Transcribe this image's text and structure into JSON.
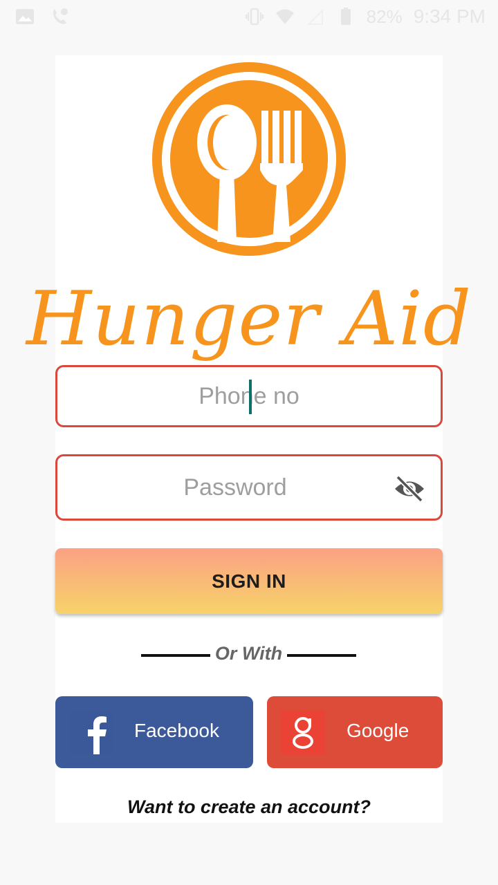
{
  "status_bar": {
    "battery": "82%",
    "time": "9:34 PM",
    "icons": [
      "image-icon",
      "phone-icon",
      "vibrate-icon",
      "wifi-icon",
      "signal-icon",
      "battery-icon"
    ]
  },
  "app": {
    "title": "Hunger Aid",
    "logo": "spoon-fork-logo",
    "accent_color": "#f7941d"
  },
  "form": {
    "phone_placeholder": "Phone no",
    "password_placeholder": "Password",
    "field_border_color": "#d9483b",
    "signin_label": "SIGN IN"
  },
  "divider": {
    "text": "Or With"
  },
  "social": {
    "facebook_label": "Facebook",
    "facebook_color": "#3c5a99",
    "google_label": "Google",
    "google_color": "#dd4b39"
  },
  "footer": {
    "create_account": "Want to create an account?"
  }
}
